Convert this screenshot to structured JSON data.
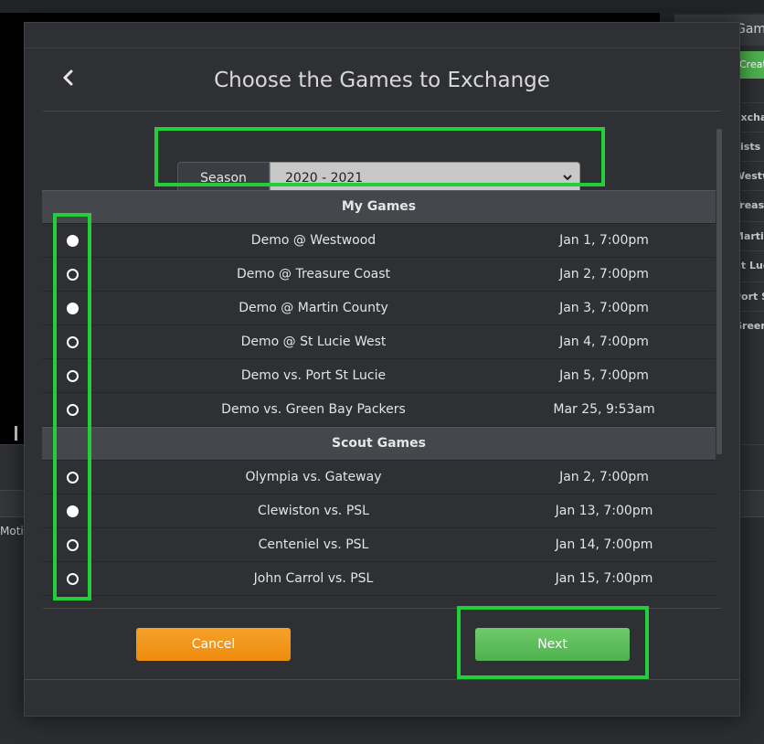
{
  "background": {
    "panel_title": "Games",
    "create_button": "Create Game",
    "list_items": [
      "Exchanged",
      "Lists",
      "Westwood",
      "Treasure",
      "Martin",
      "St Lucie",
      "Port St",
      "Green"
    ],
    "motion_label": "Motion"
  },
  "modal": {
    "title": "Choose the Games to Exchange",
    "back_icon": "chevron-left-icon",
    "season": {
      "label": "Season",
      "selected": "2020 - 2021"
    },
    "sections": [
      {
        "title": "My Games",
        "games": [
          {
            "name": "Demo @ Westwood",
            "time": "Jan 1, 7:00pm",
            "selected": true
          },
          {
            "name": "Demo @ Treasure Coast",
            "time": "Jan 2, 7:00pm",
            "selected": false
          },
          {
            "name": "Demo @ Martin County",
            "time": "Jan 3, 7:00pm",
            "selected": true
          },
          {
            "name": "Demo @ St Lucie West",
            "time": "Jan 4, 7:00pm",
            "selected": false
          },
          {
            "name": "Demo vs. Port St Lucie",
            "time": "Jan 5, 7:00pm",
            "selected": false
          },
          {
            "name": "Demo vs. Green Bay Packers",
            "time": "Mar 25, 9:53am",
            "selected": false
          }
        ]
      },
      {
        "title": "Scout Games",
        "games": [
          {
            "name": "Olympia vs. Gateway",
            "time": "Jan 2, 7:00pm",
            "selected": false
          },
          {
            "name": "Clewiston vs. PSL",
            "time": "Jan 13, 7:00pm",
            "selected": true
          },
          {
            "name": "Centeniel vs. PSL",
            "time": "Jan 14, 7:00pm",
            "selected": false
          },
          {
            "name": "John Carrol vs. PSL",
            "time": "Jan 15, 7:00pm",
            "selected": false
          }
        ]
      }
    ],
    "cancel_label": "Cancel",
    "next_label": "Next"
  },
  "colors": {
    "accent_highlight": "#22cf3a",
    "cancel_button": "#f0920f",
    "next_button": "#5cbd58",
    "modal_bg": "#2e3033"
  }
}
